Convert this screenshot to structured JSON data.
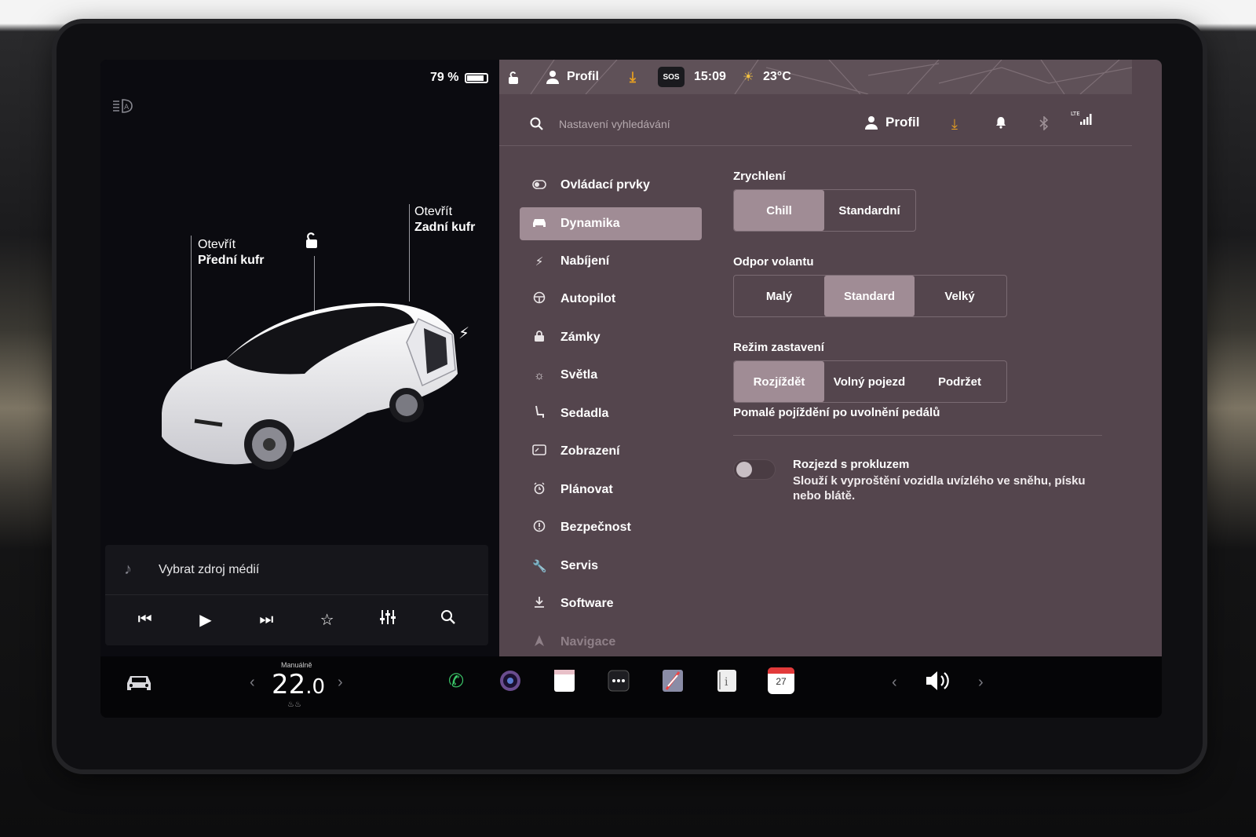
{
  "status_bar": {
    "battery_percent": "79 %",
    "battery_level": 0.79,
    "profile": "Profil",
    "sos": "SOS",
    "time": "15:09",
    "temperature": "23°C"
  },
  "car_view": {
    "front_trunk": {
      "action": "Otevřít",
      "name": "Přední kufr"
    },
    "rear_trunk": {
      "action": "Otevřít",
      "name": "Zadní kufr"
    }
  },
  "media": {
    "source_label": "Vybrat zdroj médií"
  },
  "search": {
    "placeholder": "Nastavení vyhledávání",
    "profile": "Profil"
  },
  "menu": {
    "items": [
      {
        "label": "Ovládací prvky",
        "icon": "toggle-icon"
      },
      {
        "label": "Dynamika",
        "icon": "car-icon",
        "active": true
      },
      {
        "label": "Nabíjení",
        "icon": "bolt-icon"
      },
      {
        "label": "Autopilot",
        "icon": "steering-wheel-icon"
      },
      {
        "label": "Zámky",
        "icon": "lock-icon"
      },
      {
        "label": "Světla",
        "icon": "sun-icon"
      },
      {
        "label": "Sedadla",
        "icon": "seat-icon"
      },
      {
        "label": "Zobrazení",
        "icon": "display-icon"
      },
      {
        "label": "Plánovat",
        "icon": "alarm-clock-icon"
      },
      {
        "label": "Bezpečnost",
        "icon": "alert-icon"
      },
      {
        "label": "Servis",
        "icon": "wrench-icon"
      },
      {
        "label": "Software",
        "icon": "download-icon"
      },
      {
        "label": "Navigace",
        "icon": "navigation-icon"
      }
    ]
  },
  "settings": {
    "acceleration": {
      "title": "Zrychlení",
      "options": [
        "Chill",
        "Standardní"
      ],
      "selected": "Chill"
    },
    "steering": {
      "title": "Odpor volantu",
      "options": [
        "Malý",
        "Standard",
        "Velký"
      ],
      "selected": "Standard"
    },
    "stopping": {
      "title": "Režim zastavení",
      "options": [
        "Rozjíždět",
        "Volný pojezd",
        "Podržet"
      ],
      "selected": "Rozjíždět",
      "hint": "Pomalé pojíždění po uvolnění pedálů"
    },
    "slip_start": {
      "title": "Rozjezd s prokluzem",
      "description": "Slouží k vyproštění vozidla uvízlého ve sněhu, písku nebo blátě.",
      "enabled": false
    }
  },
  "dock": {
    "climate_mode": "Manuálně",
    "temp_int": "22",
    "temp_dec": ".0",
    "calendar_day": "27"
  },
  "colors": {
    "panel_bg": "#54454d",
    "selected_bg": "#a08c95",
    "accent_orange": "#e8a020"
  }
}
